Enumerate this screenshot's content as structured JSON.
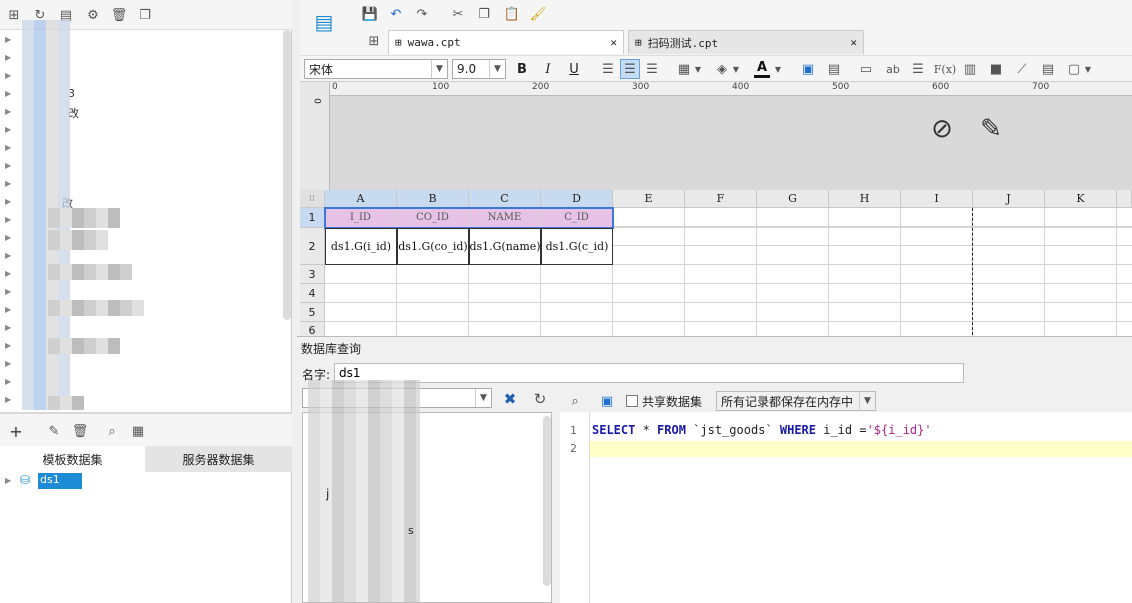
{
  "left_panel": {
    "tree_partial_texts": [
      "3",
      "改",
      "改"
    ],
    "dataset_tabs": [
      "模板数据集",
      "服务器数据集"
    ],
    "dataset_item": "ds1"
  },
  "doc_tabs": [
    {
      "label": "wawa.cpt",
      "close": "✕"
    },
    {
      "label": "扫码测试.cpt",
      "close": "✕"
    }
  ],
  "format_bar": {
    "font_name": "宋体",
    "font_size": "9.0",
    "bold": "B",
    "italic": "I",
    "underline": "U",
    "text_ab": "ab",
    "text_fx": "F(x)"
  },
  "ruler_ticks": [
    "0",
    "100",
    "200",
    "300",
    "400",
    "500",
    "600",
    "700"
  ],
  "vruler_label": "0",
  "grid": {
    "columns": [
      "A",
      "B",
      "C",
      "D",
      "E",
      "F",
      "G",
      "H",
      "I",
      "J",
      "K"
    ],
    "rows": [
      "1",
      "2",
      "3",
      "4",
      "5",
      "6"
    ],
    "header_row": [
      "I_ID",
      "CO_ID",
      "NAME",
      "C_ID"
    ],
    "data_row": [
      "ds1.G(i_id)",
      "ds1.G(co_id)",
      "ds1.G(name)",
      "ds1.G(c_id)"
    ]
  },
  "query_dialog": {
    "title": "数据库查询",
    "name_label": "名字:",
    "name_value": "ds1",
    "shared_dataset_label": "共享数据集",
    "cache_option": "所有记录都保存在内存中",
    "partial_letters": [
      "j",
      "s"
    ],
    "sql_line_numbers": [
      "1",
      "2"
    ],
    "sql": {
      "kw_select": "SELECT",
      "star": " * ",
      "kw_from": "FROM",
      "table": " `jst_goods` ",
      "kw_where": "WHERE",
      "cond": " i_id =",
      "param": "'${i_id}'"
    }
  },
  "colors": {
    "header_cell_bg": "#e6c2e6",
    "selection_border": "#3b78d8",
    "sql_keyword": "#1a1aa8",
    "sql_string": "#b0208c",
    "current_line": "#ffffc8"
  }
}
